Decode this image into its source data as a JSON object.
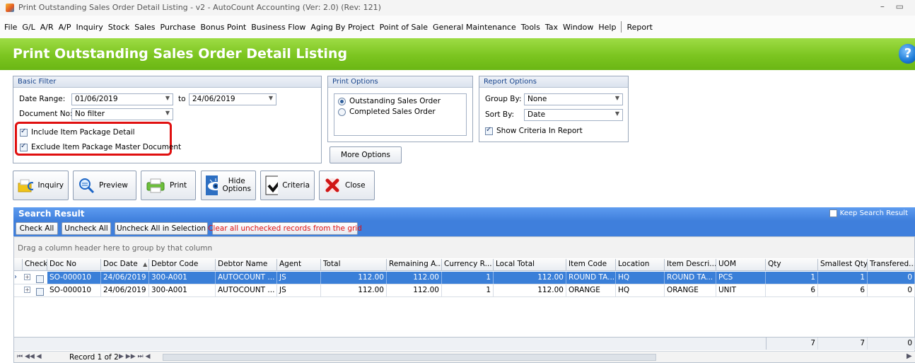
{
  "window": {
    "title": "Print Outstanding Sales Order Detail Listing - v2 - AutoCount Accounting (Ver: 2.0) (Rev: 121)",
    "controls": "– ▭"
  },
  "menu": [
    "File",
    "G/L",
    "A/R",
    "A/P",
    "Inquiry",
    "Stock",
    "Sales",
    "Purchase",
    "Bonus Point",
    "Business Flow",
    "Aging By Project",
    "Point of Sale",
    "General Maintenance",
    "Tools",
    "Tax",
    "Window",
    "Help",
    "Report"
  ],
  "header": {
    "title": "Print Outstanding Sales Order Detail Listing",
    "help": "?"
  },
  "basic_filter": {
    "title": "Basic Filter",
    "date_range_label": "Date Range:",
    "date_from": "01/06/2019",
    "to_label": "to",
    "date_to": "24/06/2019",
    "doc_no_label": "Document No:",
    "doc_no_value": "No filter",
    "include_pkg": "Include Item Package Detail",
    "exclude_pkg": "Exclude Item Package Master Document"
  },
  "print_options": {
    "title": "Print Options",
    "opt1": "Outstanding Sales Order",
    "opt2": "Completed Sales Order",
    "more": "More Options"
  },
  "report_options": {
    "title": "Report Options",
    "group_label": "Group By:",
    "group_value": "None",
    "sort_label": "Sort By:",
    "sort_value": "Date",
    "show_criteria": "Show Criteria In Report"
  },
  "toolbar": {
    "inquiry": "Inquiry",
    "preview": "Preview",
    "print": "Print",
    "hide1": "Hide",
    "hide2": "Options",
    "criteria": "Criteria",
    "close": "Close"
  },
  "search": {
    "title": "Search Result",
    "keep": "Keep Search Result",
    "check_all": "Check All",
    "uncheck_all": "Uncheck All",
    "uncheck_sel": "Uncheck All in Selection",
    "clear": "Clear all unchecked records from the grid",
    "group_hint": "Drag a column header here to group by that column"
  },
  "grid": {
    "headers": {
      "check": "Check",
      "doc_no": "Doc No",
      "doc_date": "Doc Date",
      "debtor_code": "Debtor Code",
      "debtor_name": "Debtor Name",
      "agent": "Agent",
      "total": "Total",
      "remaining": "Remaining A...",
      "currency": "Currency R...",
      "local_total": "Local Total",
      "item_code": "Item Code",
      "location": "Location",
      "item_desc": "Item Descri...",
      "uom": "UOM",
      "qty": "Qty",
      "smallest_qty": "Smallest Qty",
      "transferred": "Transfered..."
    },
    "rows": [
      {
        "doc_no": "SO-000010",
        "doc_date": "24/06/2019",
        "debtor_code": "300-A001",
        "debtor_name": "AUTOCOUNT ...",
        "agent": "JS",
        "total": "112.00",
        "remaining": "112.00",
        "currency": "1",
        "local_total": "112.00",
        "item_code": "ROUND TA...",
        "location": "HQ",
        "item_desc": "ROUND TA...",
        "uom": "PCS",
        "qty": "1",
        "smallest_qty": "1",
        "transferred": "0"
      },
      {
        "doc_no": "SO-000010",
        "doc_date": "24/06/2019",
        "debtor_code": "300-A001",
        "debtor_name": "AUTOCOUNT ...",
        "agent": "JS",
        "total": "112.00",
        "remaining": "112.00",
        "currency": "1",
        "local_total": "112.00",
        "item_code": "ORANGE",
        "location": "HQ",
        "item_desc": "ORANGE",
        "uom": "UNIT",
        "qty": "6",
        "smallest_qty": "6",
        "transferred": "0"
      }
    ],
    "footer": {
      "qty": "7",
      "smallest_qty": "7",
      "transferred": "0"
    },
    "navigator": "Record 1 of 2"
  }
}
